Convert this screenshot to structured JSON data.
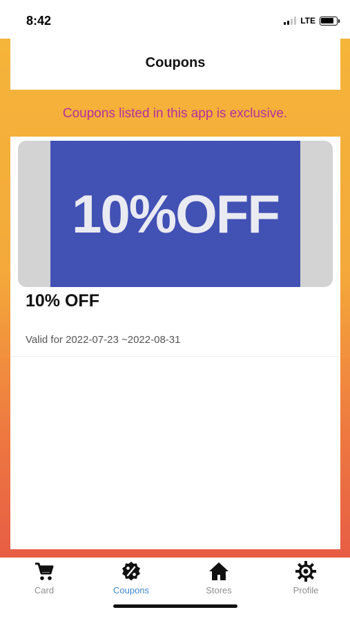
{
  "status_bar": {
    "time": "8:42",
    "network": "LTE",
    "icons": [
      "signal-icon",
      "battery-icon"
    ]
  },
  "header": {
    "title": "Coupons"
  },
  "notice": "Coupons listed in this app is exclusive.",
  "coupons": [
    {
      "image_text": "10%OFF",
      "title": "10% OFF",
      "validity": "Valid for 2022-07-23 ~2022-08-31"
    }
  ],
  "tab_bar": {
    "tabs": [
      {
        "label": "Card",
        "icon": "cart-icon",
        "active": false
      },
      {
        "label": "Coupons",
        "icon": "percent-badge-icon",
        "active": true
      },
      {
        "label": "Stores",
        "icon": "home-icon",
        "active": false
      },
      {
        "label": "Profile",
        "icon": "gear-icon",
        "active": false
      }
    ]
  },
  "colors": {
    "background_top": "#f5b43a",
    "background_bottom": "#e75d45",
    "notice_text": "#b42fa0",
    "coupon_banner": "#4251b4",
    "active_tab": "#3f86d6",
    "inactive_tab": "#8e8e8e"
  }
}
